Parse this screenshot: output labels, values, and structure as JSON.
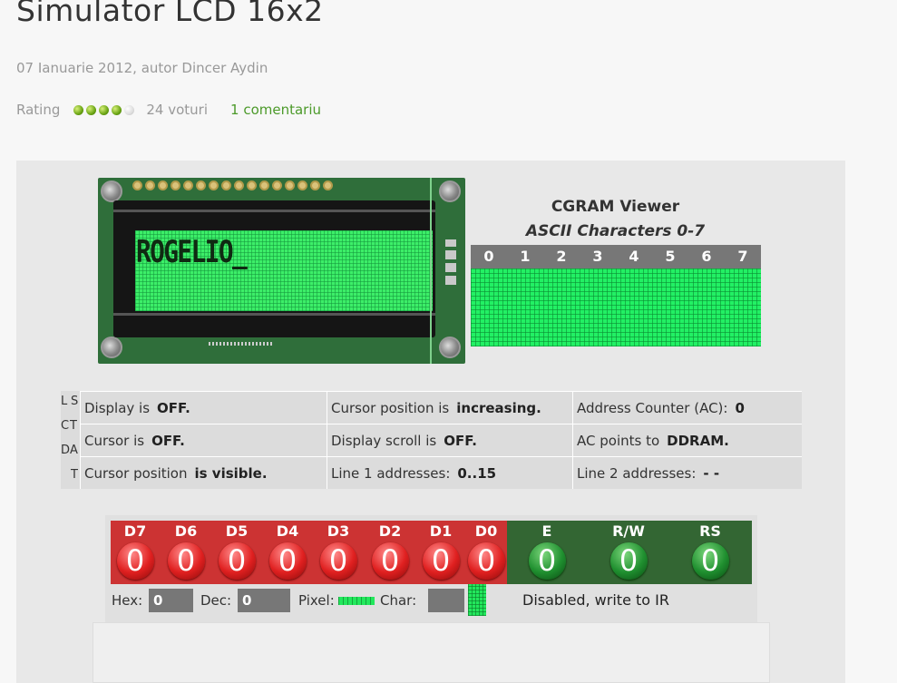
{
  "article": {
    "title": "Simulator LCD 16x2",
    "meta": "07 Ianuarie 2012,  autor Dincer Aydin",
    "rating_label": "Rating",
    "votes": "24 voturi",
    "comments": "1 comentariu",
    "rating_value": 4,
    "rating_max": 5
  },
  "lcd": {
    "line1": "ROGELIO_",
    "line2": ""
  },
  "cgram": {
    "title": "CGRAM Viewer",
    "subtitle": "ASCII Characters 0-7",
    "columns": [
      "0",
      "1",
      "2",
      "3",
      "4",
      "5",
      "6",
      "7"
    ]
  },
  "flags": [
    "L",
    "S",
    "C",
    "T",
    "D",
    "A",
    "T"
  ],
  "status": {
    "display_label": "Display is",
    "display_value": "OFF.",
    "cursor_label": "Cursor is",
    "cursor_value": "OFF.",
    "cursor_pos_label": "Cursor position",
    "cursor_pos_value": "is visible.",
    "cursor_dir_label": "Cursor position is",
    "cursor_dir_value": "increasing.",
    "scroll_label": "Display scroll is",
    "scroll_value": "OFF.",
    "line1_label": "Line 1 addresses:",
    "line1_value": "0..15",
    "ac_label": "Address Counter (AC):",
    "ac_value": "0",
    "acpoints_label": "AC points to",
    "acpoints_value": "DDRAM.",
    "line2_label": "Line 2 addresses:",
    "line2_value": "- -"
  },
  "bits": {
    "data": [
      {
        "label": "D7",
        "value": "0"
      },
      {
        "label": "D6",
        "value": "0"
      },
      {
        "label": "D5",
        "value": "0"
      },
      {
        "label": "D4",
        "value": "0"
      },
      {
        "label": "D3",
        "value": "0"
      },
      {
        "label": "D2",
        "value": "0"
      },
      {
        "label": "D1",
        "value": "0"
      },
      {
        "label": "D0",
        "value": "0"
      }
    ],
    "control": [
      {
        "label": "E",
        "value": "0"
      },
      {
        "label": "R/W",
        "value": "0"
      },
      {
        "label": "RS",
        "value": "0"
      }
    ]
  },
  "readout": {
    "hex_label": "Hex:",
    "hex_value": "0",
    "dec_label": "Dec:",
    "dec_value": "0",
    "pixel_label": "Pixel:",
    "char_label": "Char:",
    "char_value": "",
    "mode": "Disabled, write to IR"
  },
  "colors": {
    "lcd_green": "#3cee68",
    "data_bits": "#cc3333",
    "control_bits": "#336633",
    "accent": "#4c9a2a"
  }
}
